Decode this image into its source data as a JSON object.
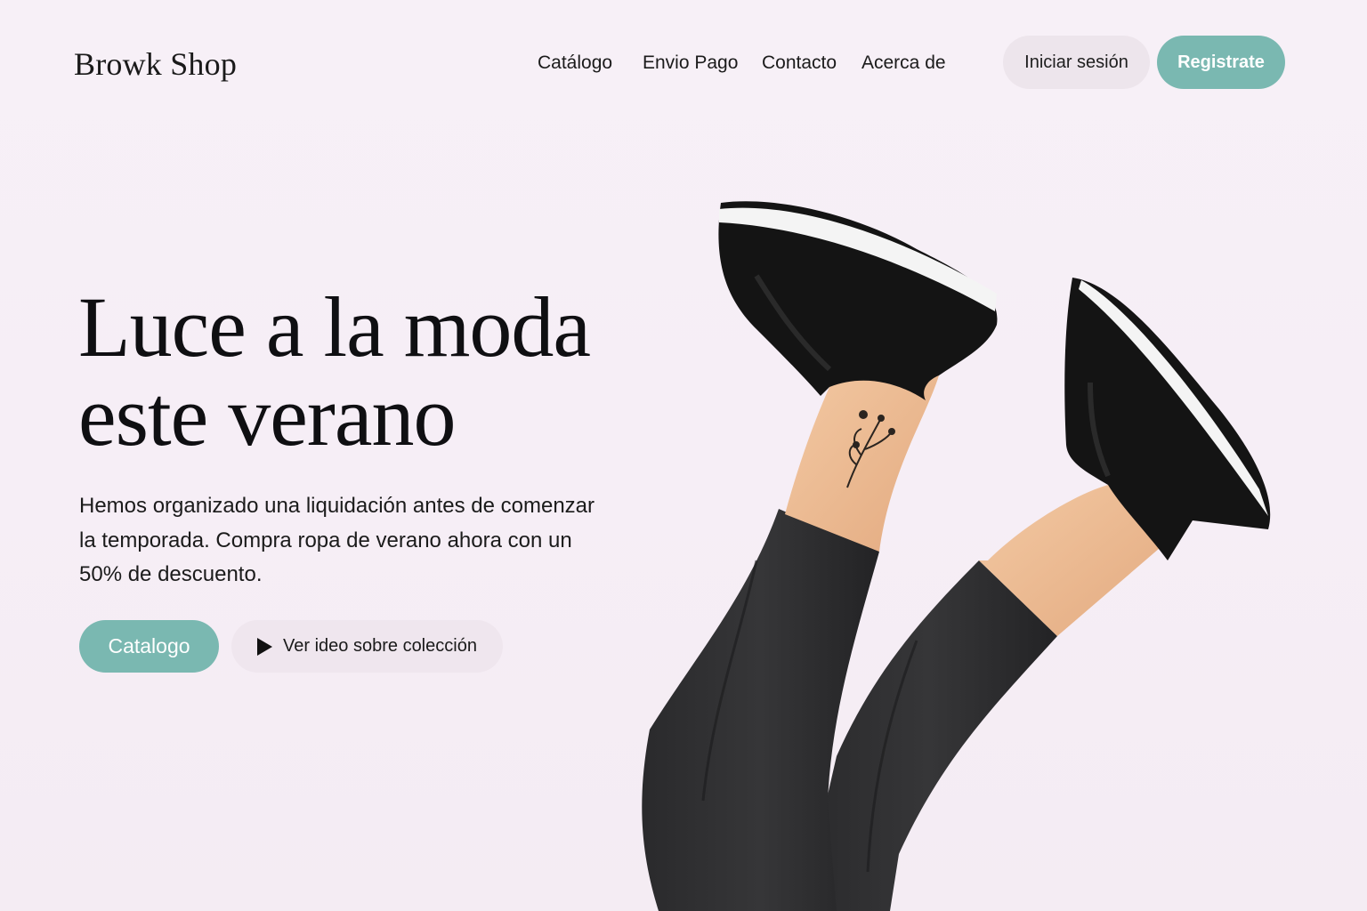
{
  "brand": {
    "name": "Browk Shop"
  },
  "nav": {
    "items": [
      {
        "label": "Catálogo"
      },
      {
        "label": "Envio Pago"
      },
      {
        "label": "Contacto"
      },
      {
        "label": "Acerca de"
      }
    ]
  },
  "auth": {
    "login_label": "Iniciar sesión",
    "signup_label": "Registrate"
  },
  "hero": {
    "headline_line1": "Luce a la moda",
    "headline_line2": "este verano",
    "description": "Hemos organizado una liquidación antes de comenzar la temporada. Compra ropa de verano ahora con un 50% de descuento.",
    "primary_button": "Catalogo",
    "secondary_button": "Ver ideo sobre colección"
  },
  "colors": {
    "accent": "#7ab8b1",
    "background": "#f7f0f7",
    "secondary_button_bg": "#efe6ee",
    "text": "#141414"
  },
  "icons": {
    "play": "play-icon"
  }
}
